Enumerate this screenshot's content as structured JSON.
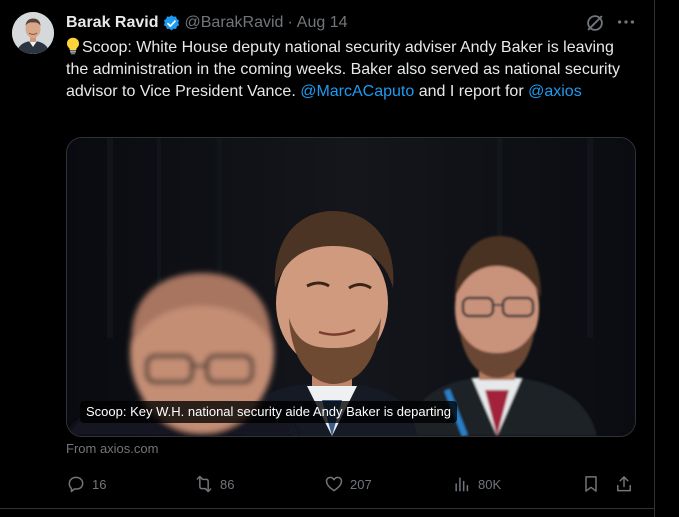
{
  "author": {
    "name": "Barak Ravid",
    "handle": "@BarakRavid",
    "separator": "·",
    "date": "Aug 14"
  },
  "post": {
    "text_main": "Scoop: White House deputy national security adviser Andy Baker is leaving the administration in the coming weeks. Baker also served as national security advisor to Vice President Vance. ",
    "mention_1": "@MarcACaputo",
    "text_mid": " and I report for ",
    "mention_2": "@axios"
  },
  "card": {
    "caption": "Scoop: Key W.H. national security aide Andy Baker is departing",
    "source": "From axios.com"
  },
  "actions": {
    "replies": "16",
    "reposts": "86",
    "likes": "207",
    "views": "80K"
  },
  "colors": {
    "background": "#000000",
    "text": "#e7e9ea",
    "muted": "#71767b",
    "link": "#1d9bf0",
    "verified": "#1d9bf0"
  },
  "icons": [
    "verified-badge-icon",
    "grok-icon",
    "more-icon",
    "lightbulb-icon",
    "reply-icon",
    "repost-icon",
    "like-icon",
    "views-icon",
    "bookmark-icon",
    "share-icon"
  ]
}
